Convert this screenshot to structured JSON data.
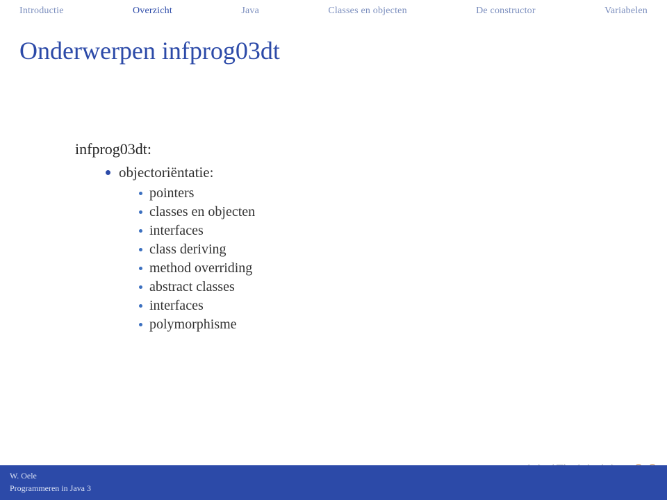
{
  "nav": {
    "items": [
      {
        "label": "Introductie",
        "active": false
      },
      {
        "label": "Overzicht",
        "active": true
      },
      {
        "label": "Java",
        "active": false
      },
      {
        "label": "Classes en objecten",
        "active": false
      },
      {
        "label": "De constructor",
        "active": false
      },
      {
        "label": "Variabelen",
        "active": false
      }
    ]
  },
  "title": "Onderwerpen infprog03dt",
  "content": {
    "heading": "infprog03dt:",
    "level2": [
      {
        "label": "objectoriëntatie:"
      }
    ],
    "level3": [
      {
        "label": "pointers"
      },
      {
        "label": "classes en objecten"
      },
      {
        "label": "interfaces"
      },
      {
        "label": "class deriving"
      },
      {
        "label": "method overriding"
      },
      {
        "label": "abstract classes"
      },
      {
        "label": "interfaces"
      },
      {
        "label": "polymorphisme"
      }
    ]
  },
  "footer": {
    "author": "W. Oele",
    "course": "Programmeren in Java 3"
  }
}
